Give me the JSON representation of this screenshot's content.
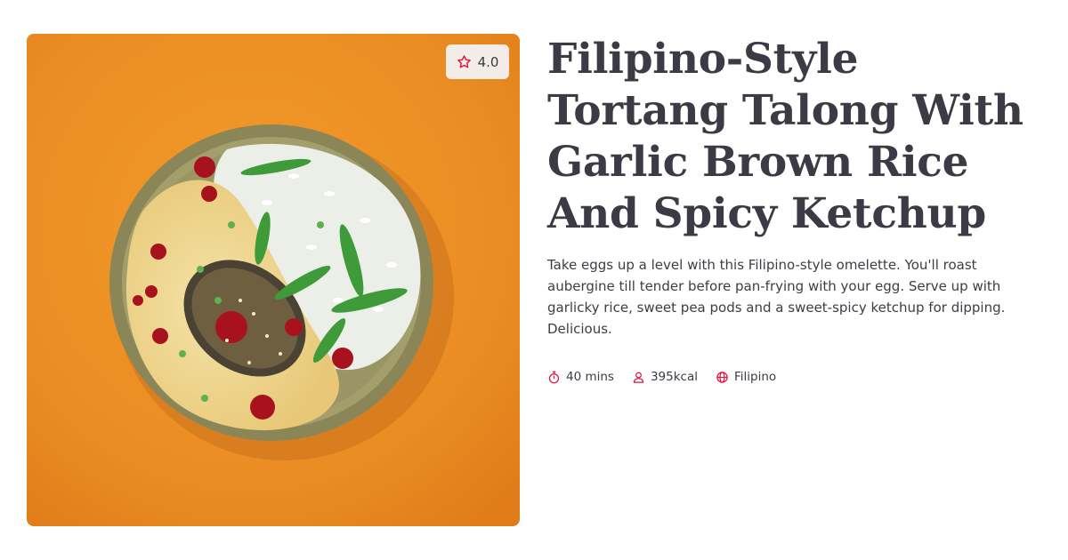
{
  "recipe": {
    "title": "Filipino-Style Tortang Talong With Garlic Brown Rice And Spicy Ketchup",
    "description": "Take eggs up a level with this Filipino-style omelette. You'll roast aubergine till tender before pan-frying with your egg. Serve up with garlicky rice, sweet pea pods and a sweet-spicy ketchup for dipping. Delicious.",
    "rating": "4.0",
    "meta": {
      "time": "40 mins",
      "calories": "395kcal",
      "cuisine": "Filipino"
    }
  },
  "icons": {
    "rating": "star-outline-icon",
    "time": "stopwatch-icon",
    "calories": "person-icon",
    "cuisine": "globe-icon"
  },
  "colors": {
    "accent": "#e0143c",
    "title": "#3b3b45",
    "background": "#ffffff",
    "image_background": "#ea8c22"
  }
}
